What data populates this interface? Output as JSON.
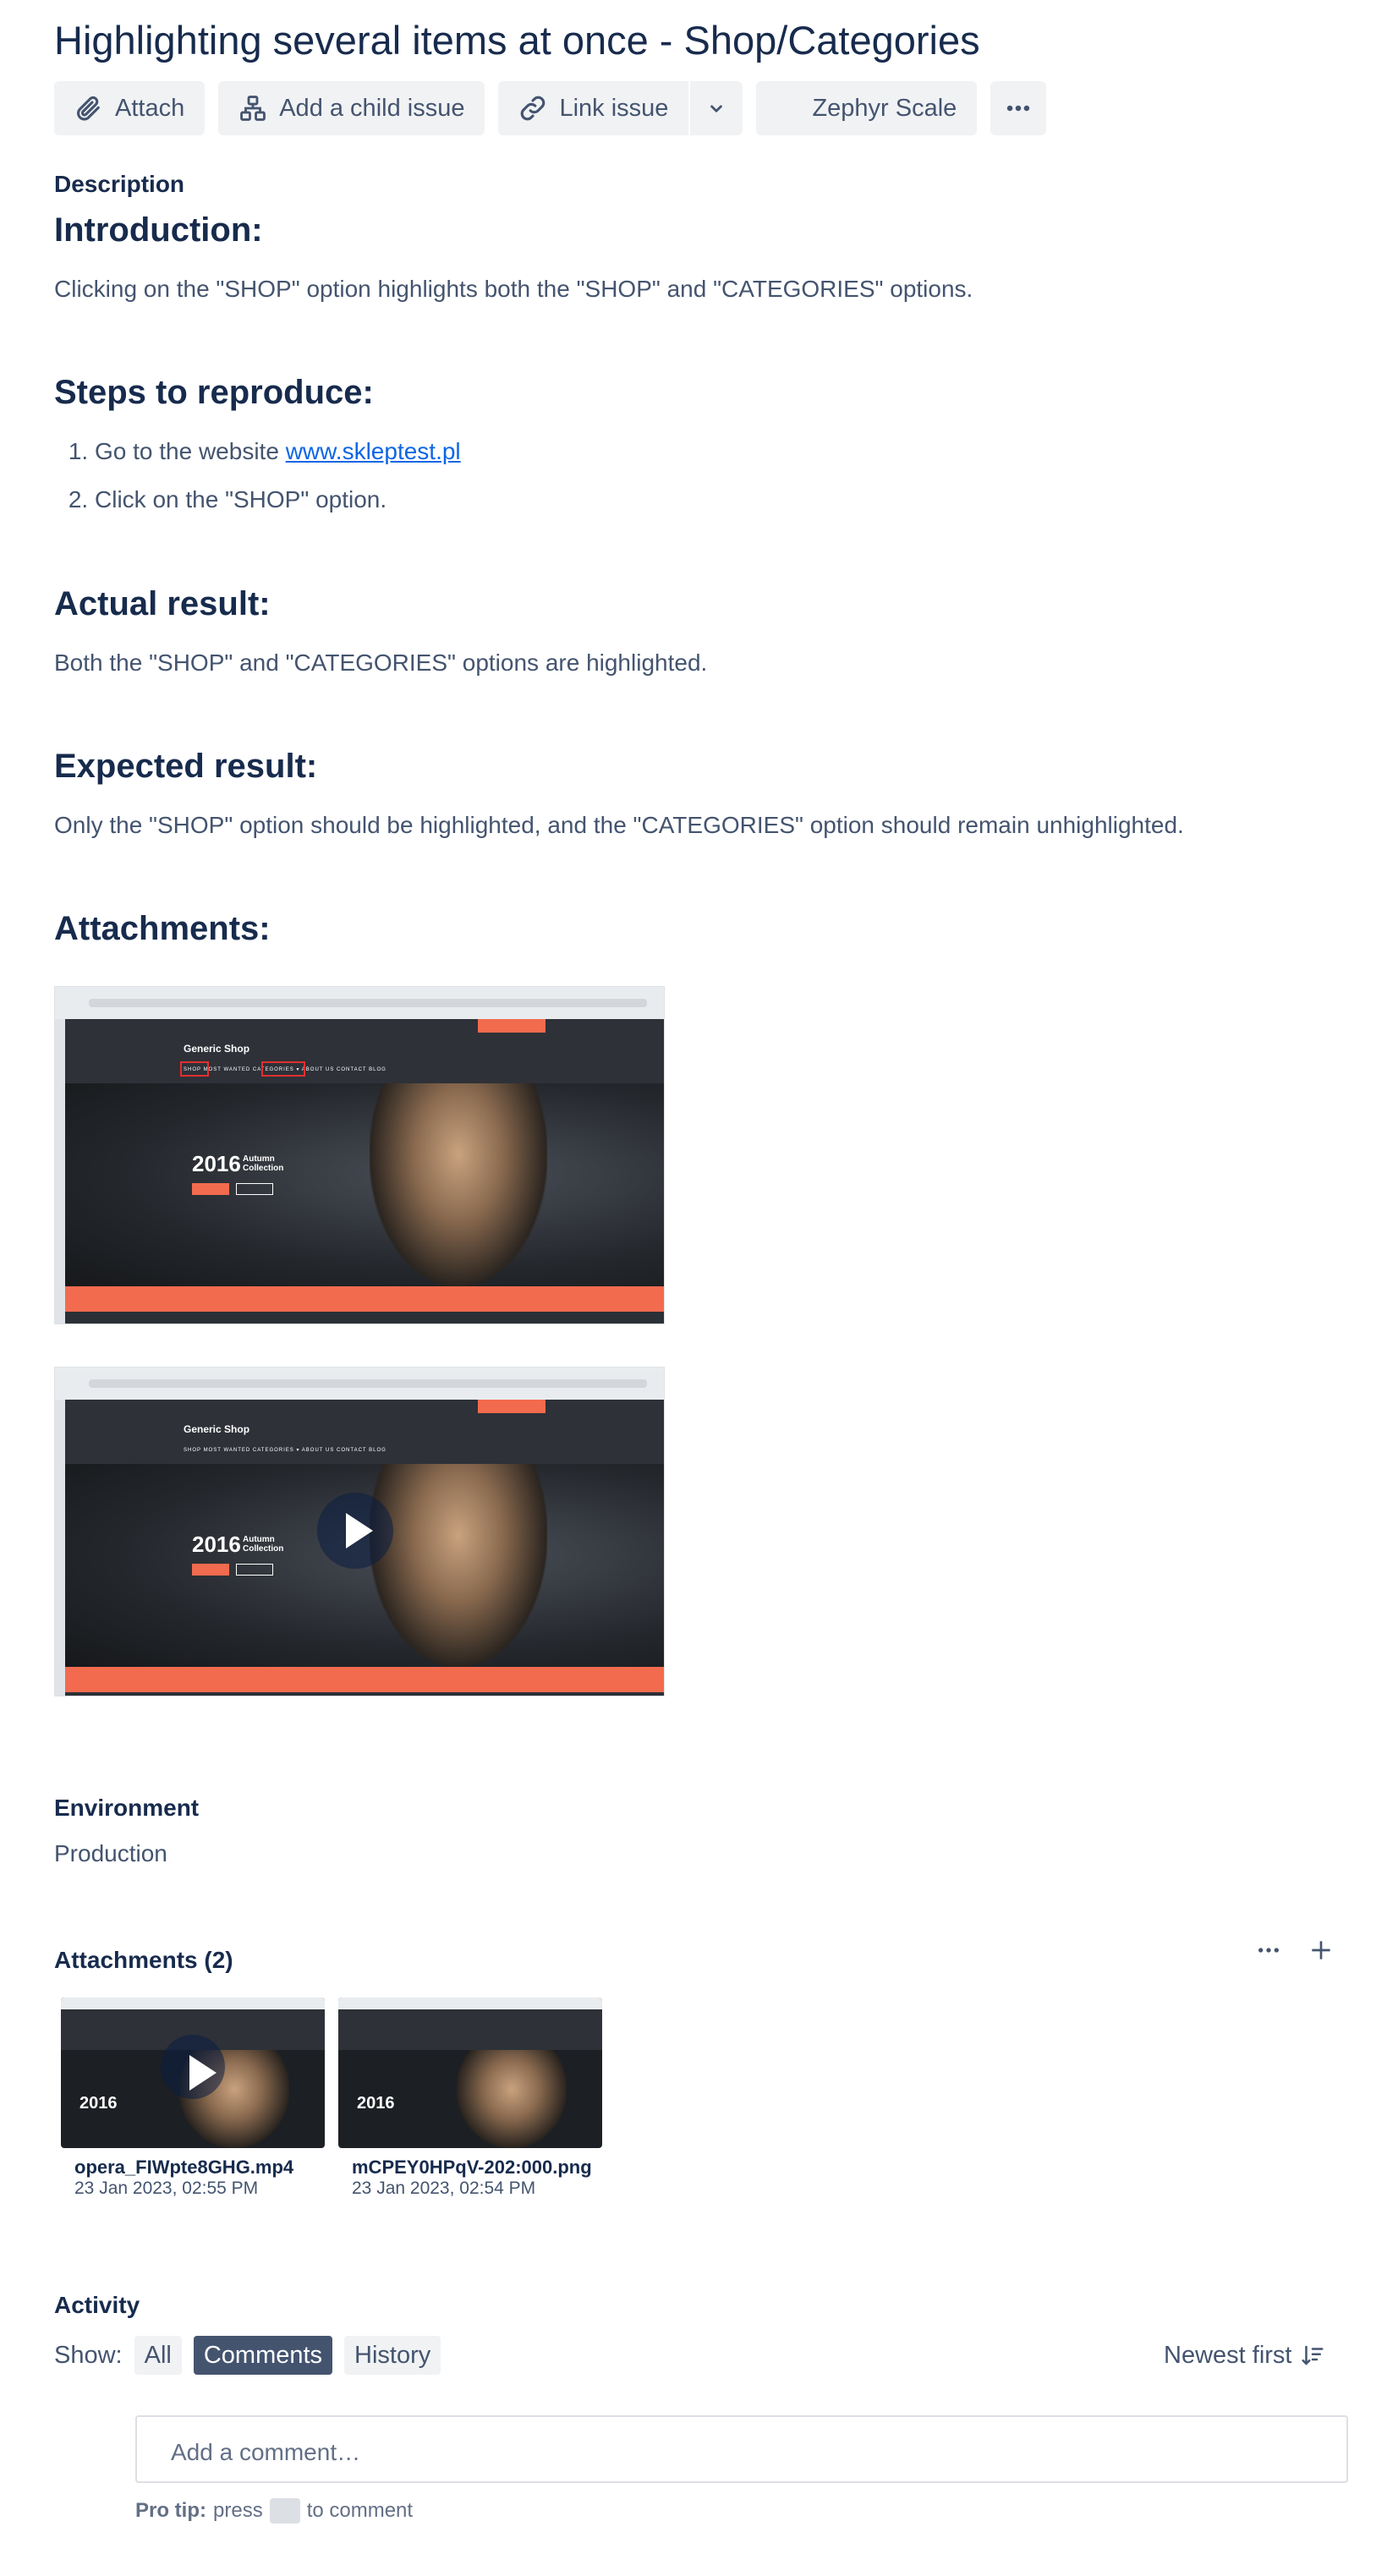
{
  "issue": {
    "title": "Highlighting several items at once - Shop/Categories"
  },
  "toolbar": {
    "attach": "Attach",
    "add_child": "Add a child issue",
    "link_issue": "Link issue",
    "zephyr": "Zephyr Scale"
  },
  "description": {
    "label": "Description",
    "intro_heading": "Introduction:",
    "intro_text": "Clicking on the \"SHOP\" option highlights both the \"SHOP\" and \"CATEGORIES\" options.",
    "steps_heading": "Steps to reproduce:",
    "steps": [
      {
        "text": "Go to the website ",
        "link": "www.skleptest.pl"
      },
      {
        "text": "Click on the \"SHOP\" option."
      }
    ],
    "actual_heading": "Actual result:",
    "actual_text": "Both the \"SHOP\" and \"CATEGORIES\" options are highlighted.",
    "expected_heading": "Expected result:",
    "expected_text": "Only the \"SHOP\" option should be highlighted, and the \"CATEGORIES\" option should remain unhighlighted.",
    "attachments_heading": "Attachments:",
    "embedded_shot": {
      "logo": "Generic Shop",
      "menu": "SHOP   MOST WANTED   CATEGORIES ▾   ABOUT US   CONTACT   BLOG",
      "year": "2016",
      "collection": "Autumn Collection"
    }
  },
  "environment": {
    "label": "Environment",
    "value": "Production"
  },
  "attachments": {
    "heading": "Attachments (2)",
    "files": [
      {
        "name": "opera_FIWpte8GHG.mp4",
        "date": "23 Jan 2023, 02:55 PM"
      },
      {
        "name": "mCPEY0HPqV-202:000.png",
        "date": "23 Jan 2023, 02:54 PM"
      }
    ]
  },
  "activity": {
    "heading": "Activity",
    "show_label": "Show:",
    "filters": [
      "All",
      "Comments",
      "History"
    ],
    "active_filter": "Comments",
    "sort": "Newest first",
    "comment_placeholder": "Add a comment…",
    "protip_bold": "Pro tip:",
    "protip_press": "press",
    "protip_rest": "to comment"
  },
  "colors": {
    "text": "#172b4d",
    "subtle": "#44546f",
    "link": "#0c66e4",
    "button_bg": "#f1f2f4",
    "shop_accent": "#f26b4f"
  }
}
